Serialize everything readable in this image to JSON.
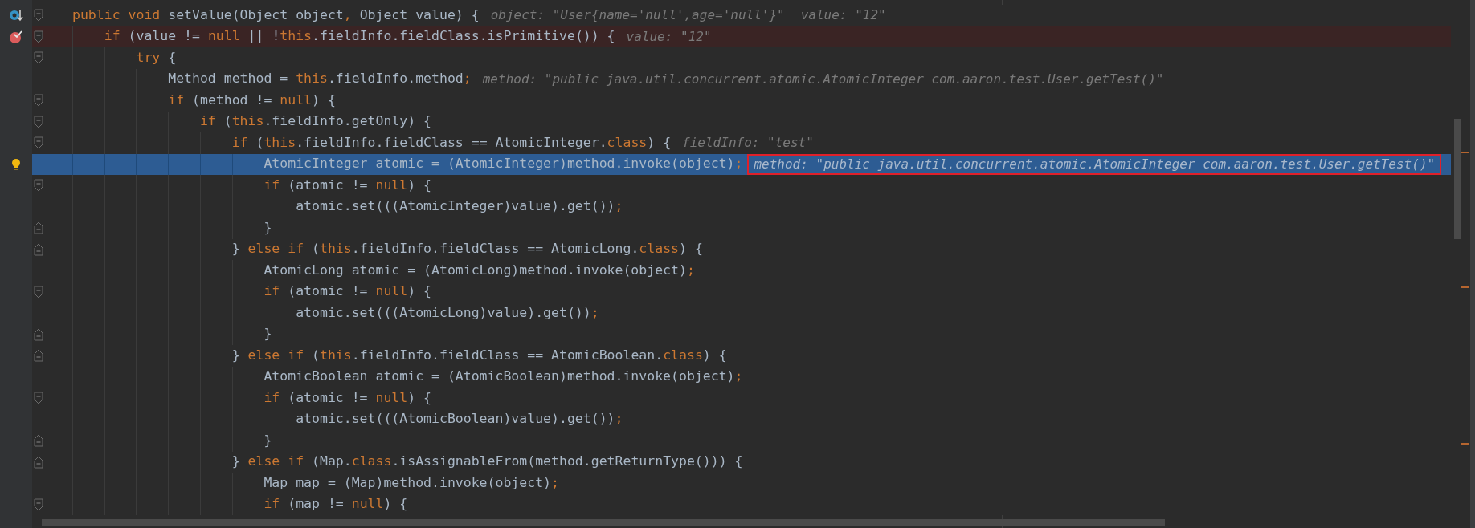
{
  "editor": {
    "lines": [
      {
        "gutter_icon": {
          "kind": "debug"
        },
        "fold": {
          "kind": "open"
        },
        "breakpoint": false,
        "current": false,
        "code": [
          {
            "kind": "keyword",
            "text": "public void "
          },
          {
            "kind": "plain",
            "text": "setValue(Object object"
          },
          {
            "kind": "keyword",
            "text": ","
          },
          {
            "kind": "plain",
            "text": " Object value) {"
          }
        ],
        "hints": [
          "object: \"User{name='null',age='null'}\"",
          "value: \"12\""
        ]
      },
      {
        "gutter_icon": {
          "kind": "breakpoint"
        },
        "fold": {
          "kind": "open"
        },
        "breakpoint": true,
        "current": false,
        "code": [
          {
            "kind": "keyword",
            "text": "    if "
          },
          {
            "kind": "plain",
            "text": "(value != "
          },
          {
            "kind": "keyword",
            "text": "null"
          },
          {
            "kind": "plain",
            "text": " || !"
          },
          {
            "kind": "keyword",
            "text": "this"
          },
          {
            "kind": "plain",
            "text": ".fieldInfo.fieldClass.isPrimitive()) {"
          }
        ],
        "hints": [
          "value: \"12\""
        ]
      },
      {
        "fold": {
          "kind": "open"
        },
        "breakpoint": false,
        "current": false,
        "code": [
          {
            "kind": "keyword",
            "text": "        try "
          },
          {
            "kind": "plain",
            "text": "{"
          }
        ]
      },
      {
        "breakpoint": false,
        "current": false,
        "code": [
          {
            "kind": "plain",
            "text": "            Method method = "
          },
          {
            "kind": "keyword",
            "text": "this"
          },
          {
            "kind": "plain",
            "text": ".fieldInfo.method"
          },
          {
            "kind": "keyword",
            "text": ";"
          }
        ],
        "hints": [
          "method: \"public java.util.concurrent.atomic.AtomicInteger com.aaron.test.User.getTest()\""
        ]
      },
      {
        "fold": {
          "kind": "open"
        },
        "breakpoint": false,
        "current": false,
        "code": [
          {
            "kind": "keyword",
            "text": "            if "
          },
          {
            "kind": "plain",
            "text": "(method != "
          },
          {
            "kind": "keyword",
            "text": "null"
          },
          {
            "kind": "plain",
            "text": ") {"
          }
        ]
      },
      {
        "fold": {
          "kind": "open"
        },
        "breakpoint": false,
        "current": false,
        "code": [
          {
            "kind": "keyword",
            "text": "                if "
          },
          {
            "kind": "plain",
            "text": "("
          },
          {
            "kind": "keyword",
            "text": "this"
          },
          {
            "kind": "plain",
            "text": ".fieldInfo.getOnly) {"
          }
        ]
      },
      {
        "fold": {
          "kind": "open"
        },
        "breakpoint": false,
        "current": false,
        "code": [
          {
            "kind": "keyword",
            "text": "                    if "
          },
          {
            "kind": "plain",
            "text": "("
          },
          {
            "kind": "keyword",
            "text": "this"
          },
          {
            "kind": "plain",
            "text": ".fieldInfo.fieldClass == AtomicInteger."
          },
          {
            "kind": "keyword",
            "text": "class"
          },
          {
            "kind": "plain",
            "text": ") {"
          }
        ],
        "hints": [
          "fieldInfo: \"test\""
        ]
      },
      {
        "gutter_icon": {
          "kind": "intention"
        },
        "breakpoint": false,
        "current": true,
        "hint_boxed": true,
        "code": [
          {
            "kind": "plain",
            "text": "                        AtomicInteger atomic = (AtomicInteger)method.invoke(object)"
          },
          {
            "kind": "keyword",
            "text": ";"
          }
        ],
        "hints": [
          "method: \"public java.util.concurrent.atomic.AtomicInteger com.aaron.test.User.getTest()\""
        ]
      },
      {
        "fold": {
          "kind": "open"
        },
        "breakpoint": false,
        "current": false,
        "code": [
          {
            "kind": "keyword",
            "text": "                        if "
          },
          {
            "kind": "plain",
            "text": "(atomic != "
          },
          {
            "kind": "keyword",
            "text": "null"
          },
          {
            "kind": "plain",
            "text": ") {"
          }
        ]
      },
      {
        "breakpoint": false,
        "current": false,
        "code": [
          {
            "kind": "plain",
            "text": "                            atomic.set(((AtomicInteger)value).get())"
          },
          {
            "kind": "keyword",
            "text": ";"
          }
        ]
      },
      {
        "fold": {
          "kind": "close"
        },
        "breakpoint": false,
        "current": false,
        "code": [
          {
            "kind": "plain",
            "text": "                        }"
          }
        ]
      },
      {
        "fold": {
          "kind": "close"
        },
        "breakpoint": false,
        "current": false,
        "code": [
          {
            "kind": "plain",
            "text": "                    } "
          },
          {
            "kind": "keyword",
            "text": "else if "
          },
          {
            "kind": "plain",
            "text": "("
          },
          {
            "kind": "keyword",
            "text": "this"
          },
          {
            "kind": "plain",
            "text": ".fieldInfo.fieldClass == AtomicLong."
          },
          {
            "kind": "keyword",
            "text": "class"
          },
          {
            "kind": "plain",
            "text": ") {"
          }
        ]
      },
      {
        "breakpoint": false,
        "current": false,
        "code": [
          {
            "kind": "plain",
            "text": "                        AtomicLong atomic = (AtomicLong)method.invoke(object)"
          },
          {
            "kind": "keyword",
            "text": ";"
          }
        ]
      },
      {
        "fold": {
          "kind": "open"
        },
        "breakpoint": false,
        "current": false,
        "code": [
          {
            "kind": "keyword",
            "text": "                        if "
          },
          {
            "kind": "plain",
            "text": "(atomic != "
          },
          {
            "kind": "keyword",
            "text": "null"
          },
          {
            "kind": "plain",
            "text": ") {"
          }
        ]
      },
      {
        "breakpoint": false,
        "current": false,
        "code": [
          {
            "kind": "plain",
            "text": "                            atomic.set(((AtomicLong)value).get())"
          },
          {
            "kind": "keyword",
            "text": ";"
          }
        ]
      },
      {
        "fold": {
          "kind": "close"
        },
        "breakpoint": false,
        "current": false,
        "code": [
          {
            "kind": "plain",
            "text": "                        }"
          }
        ]
      },
      {
        "fold": {
          "kind": "close"
        },
        "breakpoint": false,
        "current": false,
        "code": [
          {
            "kind": "plain",
            "text": "                    } "
          },
          {
            "kind": "keyword",
            "text": "else if "
          },
          {
            "kind": "plain",
            "text": "("
          },
          {
            "kind": "keyword",
            "text": "this"
          },
          {
            "kind": "plain",
            "text": ".fieldInfo.fieldClass == AtomicBoolean."
          },
          {
            "kind": "keyword",
            "text": "class"
          },
          {
            "kind": "plain",
            "text": ") {"
          }
        ]
      },
      {
        "breakpoint": false,
        "current": false,
        "code": [
          {
            "kind": "plain",
            "text": "                        AtomicBoolean atomic = (AtomicBoolean)method.invoke(object)"
          },
          {
            "kind": "keyword",
            "text": ";"
          }
        ]
      },
      {
        "fold": {
          "kind": "open"
        },
        "breakpoint": false,
        "current": false,
        "code": [
          {
            "kind": "keyword",
            "text": "                        if "
          },
          {
            "kind": "plain",
            "text": "(atomic != "
          },
          {
            "kind": "keyword",
            "text": "null"
          },
          {
            "kind": "plain",
            "text": ") {"
          }
        ]
      },
      {
        "breakpoint": false,
        "current": false,
        "code": [
          {
            "kind": "plain",
            "text": "                            atomic.set(((AtomicBoolean)value).get())"
          },
          {
            "kind": "keyword",
            "text": ";"
          }
        ]
      },
      {
        "fold": {
          "kind": "close"
        },
        "breakpoint": false,
        "current": false,
        "code": [
          {
            "kind": "plain",
            "text": "                        }"
          }
        ]
      },
      {
        "fold": {
          "kind": "close"
        },
        "breakpoint": false,
        "current": false,
        "code": [
          {
            "kind": "plain",
            "text": "                    } "
          },
          {
            "kind": "keyword",
            "text": "else if "
          },
          {
            "kind": "plain",
            "text": "(Map."
          },
          {
            "kind": "keyword",
            "text": "class"
          },
          {
            "kind": "plain",
            "text": ".isAssignableFrom(method.getReturnType())) {"
          }
        ]
      },
      {
        "breakpoint": false,
        "current": false,
        "code": [
          {
            "kind": "plain",
            "text": "                        Map map = (Map)method.invoke(object)"
          },
          {
            "kind": "keyword",
            "text": ";"
          }
        ]
      },
      {
        "fold": {
          "kind": "open"
        },
        "breakpoint": false,
        "current": false,
        "code": [
          {
            "kind": "keyword",
            "text": "                        if "
          },
          {
            "kind": "plain",
            "text": "(map != "
          },
          {
            "kind": "keyword",
            "text": "null"
          },
          {
            "kind": "plain",
            "text": ") {"
          }
        ]
      }
    ]
  }
}
